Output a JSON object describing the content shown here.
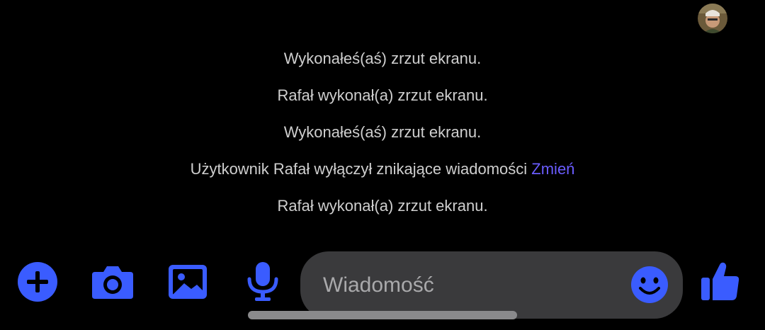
{
  "avatar": {
    "icon": "profile-photo"
  },
  "messages": [
    {
      "text": "Wykonałeś(aś) zrzut ekranu."
    },
    {
      "text": "Rafał wykonał(a) zrzut ekranu."
    },
    {
      "text": "Wykonałeś(aś) zrzut ekranu."
    },
    {
      "text": "Użytkownik Rafał wyłączył znikające wiadomości",
      "link": "Zmień"
    },
    {
      "text": "Rafał wykonał(a) zrzut ekranu."
    }
  ],
  "composer": {
    "placeholder": "Wiadomość",
    "value": ""
  },
  "icons": {
    "plus": "plus-circle-icon",
    "camera": "camera-icon",
    "gallery": "image-icon",
    "mic": "microphone-icon",
    "emoji": "emoji-icon",
    "like": "thumbs-up-icon"
  },
  "colors": {
    "accent": "#3a5cff",
    "link": "#6a5cff",
    "background": "#000000",
    "composer_bg": "#3a3a3c",
    "system_text": "#cfcfcf"
  }
}
